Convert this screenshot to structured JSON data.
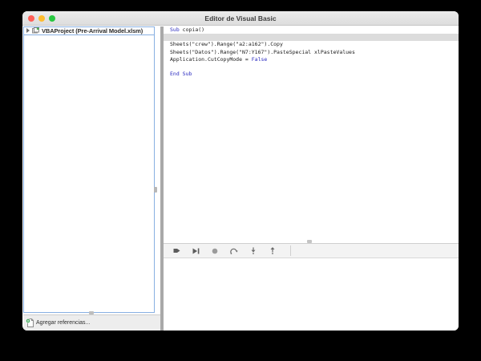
{
  "window": {
    "title": "Editor de Visual Basic"
  },
  "traffic_lights": {
    "close_color": "#ff5f57",
    "minimize_color": "#febc2e",
    "zoom_color": "#28c840"
  },
  "project_panel": {
    "item": {
      "label": "VBAProject (Pre-Arrival Model.xlsm)",
      "icon": "project-icon",
      "collapsed": true
    },
    "footer": {
      "label": "Agregar referencias...",
      "icon": "add-reference-icon"
    },
    "focus_ring_color": "#88b0e2"
  },
  "code_editor": {
    "keyword_color": "#2b2bc0",
    "highlight_color": "#dcdcdc",
    "lines": [
      {
        "segments": [
          {
            "text": "Sub",
            "type": "keyword"
          },
          {
            "text": " copia()",
            "type": "plain"
          }
        ]
      },
      {
        "highlighted": true,
        "segments": []
      },
      {
        "segments": [
          {
            "text": "Sheets(\"crew\").Range(\"a2:a162\").Copy",
            "type": "plain"
          }
        ]
      },
      {
        "segments": [
          {
            "text": "Sheets(\"Datos\").Range(\"N7:Y167\").PasteSpecial xlPasteValues",
            "type": "plain"
          }
        ]
      },
      {
        "segments": [
          {
            "text": "Application.CutCopyMode = ",
            "type": "plain"
          },
          {
            "text": "False",
            "type": "keyword"
          }
        ]
      },
      {
        "segments": []
      },
      {
        "segments": [
          {
            "text": "End Sub",
            "type": "keyword"
          }
        ]
      }
    ]
  },
  "debug_toolbar": {
    "icons": [
      {
        "name": "continue-icon"
      },
      {
        "name": "run-to-cursor-icon"
      },
      {
        "name": "breakpoint-icon"
      },
      {
        "name": "step-over-icon"
      },
      {
        "name": "step-into-icon"
      },
      {
        "name": "step-out-icon"
      }
    ]
  }
}
